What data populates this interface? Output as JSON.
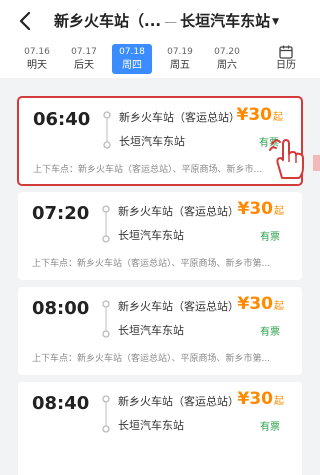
{
  "header": {
    "origin": "新乡火车站（...",
    "separator": "—",
    "destination": "长垣汽车东站",
    "caret": "▼"
  },
  "dates": [
    {
      "date": "07.16",
      "weekday": "明天"
    },
    {
      "date": "07.17",
      "weekday": "后天"
    },
    {
      "date": "07.18",
      "weekday": "周四",
      "selected": true
    },
    {
      "date": "07.19",
      "weekday": "周五"
    },
    {
      "date": "07.20",
      "weekday": "周六"
    }
  ],
  "calendar_label": "日历",
  "trips": [
    {
      "time": "06:40",
      "from": "新乡火车站（客运总站）",
      "to": "长垣汽车东站",
      "price": "¥30",
      "price_suffix": "起",
      "status": "有票",
      "stops": "上下车点：新乡火车站（客运总站）、平原商场、新乡市..."
    },
    {
      "time": "07:20",
      "from": "新乡火车站（客运总站）",
      "to": "长垣汽车东站",
      "price": "¥30",
      "price_suffix": "起",
      "status": "有票",
      "stops": "上下车点：新乡火车站（客运总站）、平原商场、新乡市第..."
    },
    {
      "time": "08:00",
      "from": "新乡火车站（客运总站）",
      "to": "长垣汽车东站",
      "price": "¥30",
      "price_suffix": "起",
      "status": "有票",
      "stops": "上下车点：新乡火车站（客运总站）、平原商场、新乡市第..."
    },
    {
      "time": "08:40",
      "from": "新乡火车站（客运总站）",
      "to": "长垣汽车东站",
      "price": "¥30",
      "price_suffix": "起",
      "status": "有票",
      "stops": ""
    }
  ],
  "colors": {
    "accent": "#3b8cff",
    "price": "#ff8a00",
    "available": "#2aa14b",
    "highlight": "#d33a3a"
  }
}
